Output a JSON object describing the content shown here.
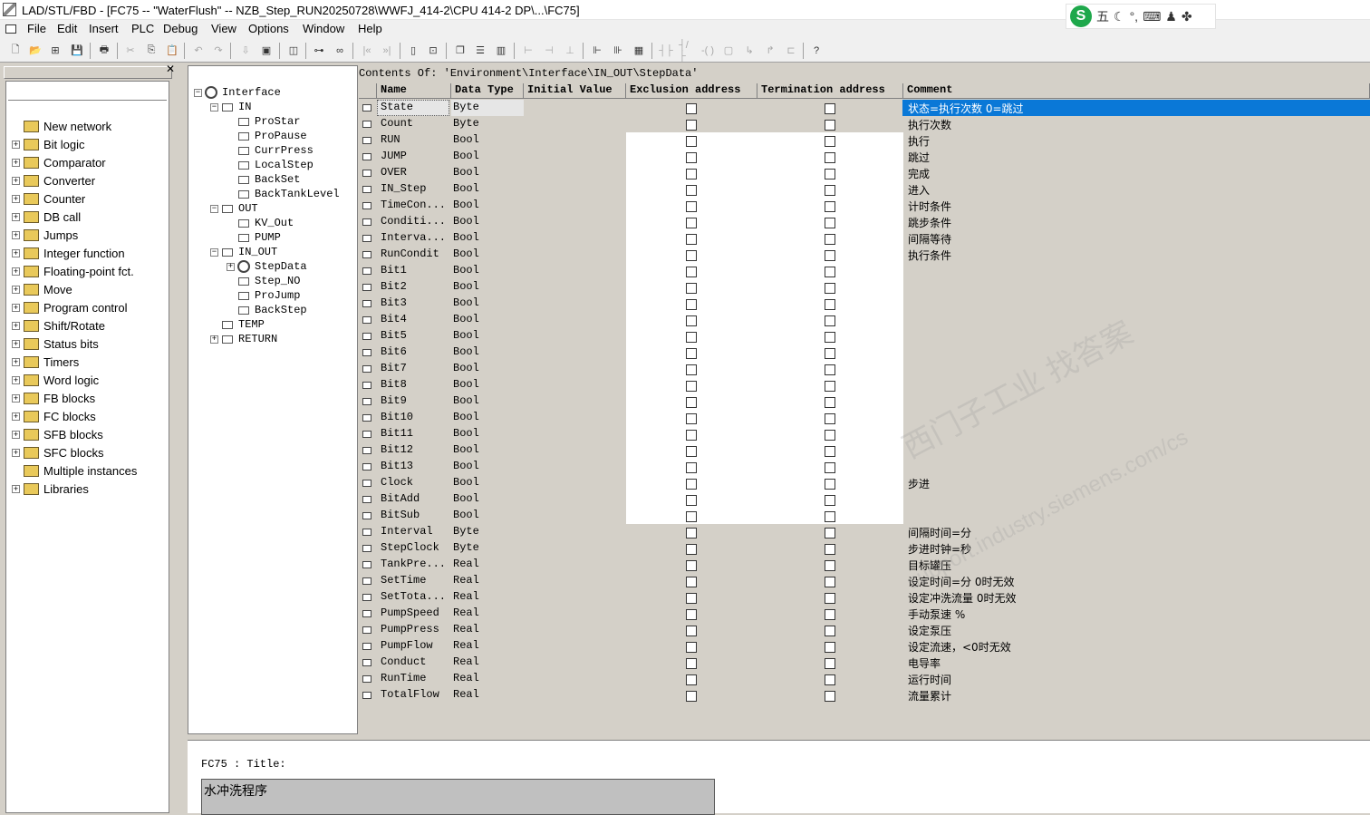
{
  "window": {
    "title": "LAD/STL/FBD  - [FC75 -- \"WaterFlush\" -- NZB_Step_RUN20250728\\WWFJ_414-2\\CPU 414-2 DP\\...\\FC75]"
  },
  "ime": {
    "mode": "五",
    "icons": [
      "moon-icon",
      "punctuation-icon",
      "keyboard-icon",
      "user-icon",
      "grid-icon"
    ]
  },
  "menu": [
    "File",
    "Edit",
    "Insert",
    "PLC",
    "Debug",
    "View",
    "Options",
    "Window",
    "Help"
  ],
  "catalog": {
    "items": [
      {
        "label": "New network",
        "icon": "new-network-icon",
        "expand": false
      },
      {
        "label": "Bit logic",
        "icon": "bit-logic-icon",
        "expand": true
      },
      {
        "label": "Comparator",
        "icon": "comparator-icon",
        "expand": true
      },
      {
        "label": "Converter",
        "icon": "converter-icon",
        "expand": true
      },
      {
        "label": "Counter",
        "icon": "counter-icon",
        "expand": true
      },
      {
        "label": "DB call",
        "icon": "db-call-icon",
        "expand": true
      },
      {
        "label": "Jumps",
        "icon": "jumps-icon",
        "expand": true
      },
      {
        "label": "Integer function",
        "icon": "integer-function-icon",
        "expand": true
      },
      {
        "label": "Floating-point fct.",
        "icon": "floating-point-icon",
        "expand": true
      },
      {
        "label": "Move",
        "icon": "move-icon",
        "expand": true
      },
      {
        "label": "Program control",
        "icon": "program-control-icon",
        "expand": true
      },
      {
        "label": "Shift/Rotate",
        "icon": "shift-rotate-icon",
        "expand": true
      },
      {
        "label": "Status bits",
        "icon": "status-bits-icon",
        "expand": true
      },
      {
        "label": "Timers",
        "icon": "timers-icon",
        "expand": true
      },
      {
        "label": "Word logic",
        "icon": "word-logic-icon",
        "expand": true
      },
      {
        "label": "FB blocks",
        "icon": "fb-blocks-icon",
        "expand": true
      },
      {
        "label": "FC blocks",
        "icon": "fc-blocks-icon",
        "expand": true
      },
      {
        "label": "SFB blocks",
        "icon": "sfb-blocks-icon",
        "expand": true
      },
      {
        "label": "SFC blocks",
        "icon": "sfc-blocks-icon",
        "expand": true
      },
      {
        "label": "Multiple instances",
        "icon": "multiple-instances-icon",
        "expand": false
      },
      {
        "label": "Libraries",
        "icon": "libraries-icon",
        "expand": true
      }
    ]
  },
  "interface_tree": {
    "nodes": [
      {
        "label": "Interface",
        "level": 0,
        "pm": "−",
        "kind": "gear"
      },
      {
        "label": "IN",
        "level": 1,
        "pm": "−",
        "kind": "box"
      },
      {
        "label": "ProStar",
        "level": 2,
        "pm": "",
        "kind": "box"
      },
      {
        "label": "ProPause",
        "level": 2,
        "pm": "",
        "kind": "box"
      },
      {
        "label": "CurrPress",
        "level": 2,
        "pm": "",
        "kind": "box"
      },
      {
        "label": "LocalStep",
        "level": 2,
        "pm": "",
        "kind": "box"
      },
      {
        "label": "BackSet",
        "level": 2,
        "pm": "",
        "kind": "box"
      },
      {
        "label": "BackTankLevel",
        "level": 2,
        "pm": "",
        "kind": "box"
      },
      {
        "label": "OUT",
        "level": 1,
        "pm": "−",
        "kind": "box"
      },
      {
        "label": "KV_Out",
        "level": 2,
        "pm": "",
        "kind": "box"
      },
      {
        "label": "PUMP",
        "level": 2,
        "pm": "",
        "kind": "box"
      },
      {
        "label": "IN_OUT",
        "level": 1,
        "pm": "−",
        "kind": "box"
      },
      {
        "label": "StepData",
        "level": 2,
        "pm": "+",
        "kind": "gear"
      },
      {
        "label": "Step_NO",
        "level": 2,
        "pm": "",
        "kind": "box"
      },
      {
        "label": "ProJump",
        "level": 2,
        "pm": "",
        "kind": "box"
      },
      {
        "label": "BackStep",
        "level": 2,
        "pm": "",
        "kind": "box"
      },
      {
        "label": "TEMP",
        "level": 1,
        "pm": "",
        "kind": "box"
      },
      {
        "label": "RETURN",
        "level": 1,
        "pm": "+",
        "kind": "box"
      }
    ]
  },
  "table": {
    "contents_of": "Contents Of: 'Environment\\Interface\\IN_OUT\\StepData'",
    "headers": [
      "Name",
      "Data Type",
      "Initial Value",
      "Exclusion address",
      "Termination address",
      "Comment"
    ],
    "rows": [
      {
        "name": "State",
        "type": "Byte",
        "comment": "状态=执行次数  0=跳过"
      },
      {
        "name": "Count",
        "type": "Byte",
        "comment": "执行次数"
      },
      {
        "name": "RUN",
        "type": "Bool",
        "comment": "执行"
      },
      {
        "name": "JUMP",
        "type": "Bool",
        "comment": "跳过"
      },
      {
        "name": "OVER",
        "type": "Bool",
        "comment": "完成"
      },
      {
        "name": "IN_Step",
        "type": "Bool",
        "comment": "进入"
      },
      {
        "name": "TimeCon...",
        "type": "Bool",
        "comment": "计时条件"
      },
      {
        "name": "Conditi...",
        "type": "Bool",
        "comment": "跳步条件"
      },
      {
        "name": "Interva...",
        "type": "Bool",
        "comment": "间隔等待"
      },
      {
        "name": "RunCondit",
        "type": "Bool",
        "comment": "执行条件"
      },
      {
        "name": "Bit1",
        "type": "Bool",
        "comment": ""
      },
      {
        "name": "Bit2",
        "type": "Bool",
        "comment": ""
      },
      {
        "name": "Bit3",
        "type": "Bool",
        "comment": ""
      },
      {
        "name": "Bit4",
        "type": "Bool",
        "comment": ""
      },
      {
        "name": "Bit5",
        "type": "Bool",
        "comment": ""
      },
      {
        "name": "Bit6",
        "type": "Bool",
        "comment": ""
      },
      {
        "name": "Bit7",
        "type": "Bool",
        "comment": ""
      },
      {
        "name": "Bit8",
        "type": "Bool",
        "comment": ""
      },
      {
        "name": "Bit9",
        "type": "Bool",
        "comment": ""
      },
      {
        "name": "Bit10",
        "type": "Bool",
        "comment": ""
      },
      {
        "name": "Bit11",
        "type": "Bool",
        "comment": ""
      },
      {
        "name": "Bit12",
        "type": "Bool",
        "comment": ""
      },
      {
        "name": "Bit13",
        "type": "Bool",
        "comment": ""
      },
      {
        "name": "Clock",
        "type": "Bool",
        "comment": "步进"
      },
      {
        "name": "BitAdd",
        "type": "Bool",
        "comment": ""
      },
      {
        "name": "BitSub",
        "type": "Bool",
        "comment": ""
      },
      {
        "name": "Interval",
        "type": "Byte",
        "comment": "间隔时间=分"
      },
      {
        "name": "StepClock",
        "type": "Byte",
        "comment": "步进时钟=秒"
      },
      {
        "name": "TankPre...",
        "type": "Real",
        "comment": "目标罐压"
      },
      {
        "name": "SetTime",
        "type": "Real",
        "comment": "设定时间=分  0时无效"
      },
      {
        "name": "SetTota...",
        "type": "Real",
        "comment": "设定冲洗流量  0时无效"
      },
      {
        "name": "PumpSpeed",
        "type": "Real",
        "comment": "手动泵速 %"
      },
      {
        "name": "PumpPress",
        "type": "Real",
        "comment": "设定泵压"
      },
      {
        "name": "PumpFlow",
        "type": "Real",
        "comment": "设定流速，<0时无效"
      },
      {
        "name": "Conduct",
        "type": "Real",
        "comment": "电导率"
      },
      {
        "name": "RunTime",
        "type": "Real",
        "comment": "运行时间"
      },
      {
        "name": "TotalFlow",
        "type": "Real",
        "comment": "流量累计"
      }
    ]
  },
  "watermark": {
    "line1": "西门子工业  找答案",
    "line2": "support.industry.siemens.com/cs"
  },
  "bottom": {
    "title_label": "FC75 : Title:",
    "title_value": "水冲洗程序"
  },
  "colors": {
    "selection": "#0a78d7",
    "panel": "#d4d0c8"
  }
}
